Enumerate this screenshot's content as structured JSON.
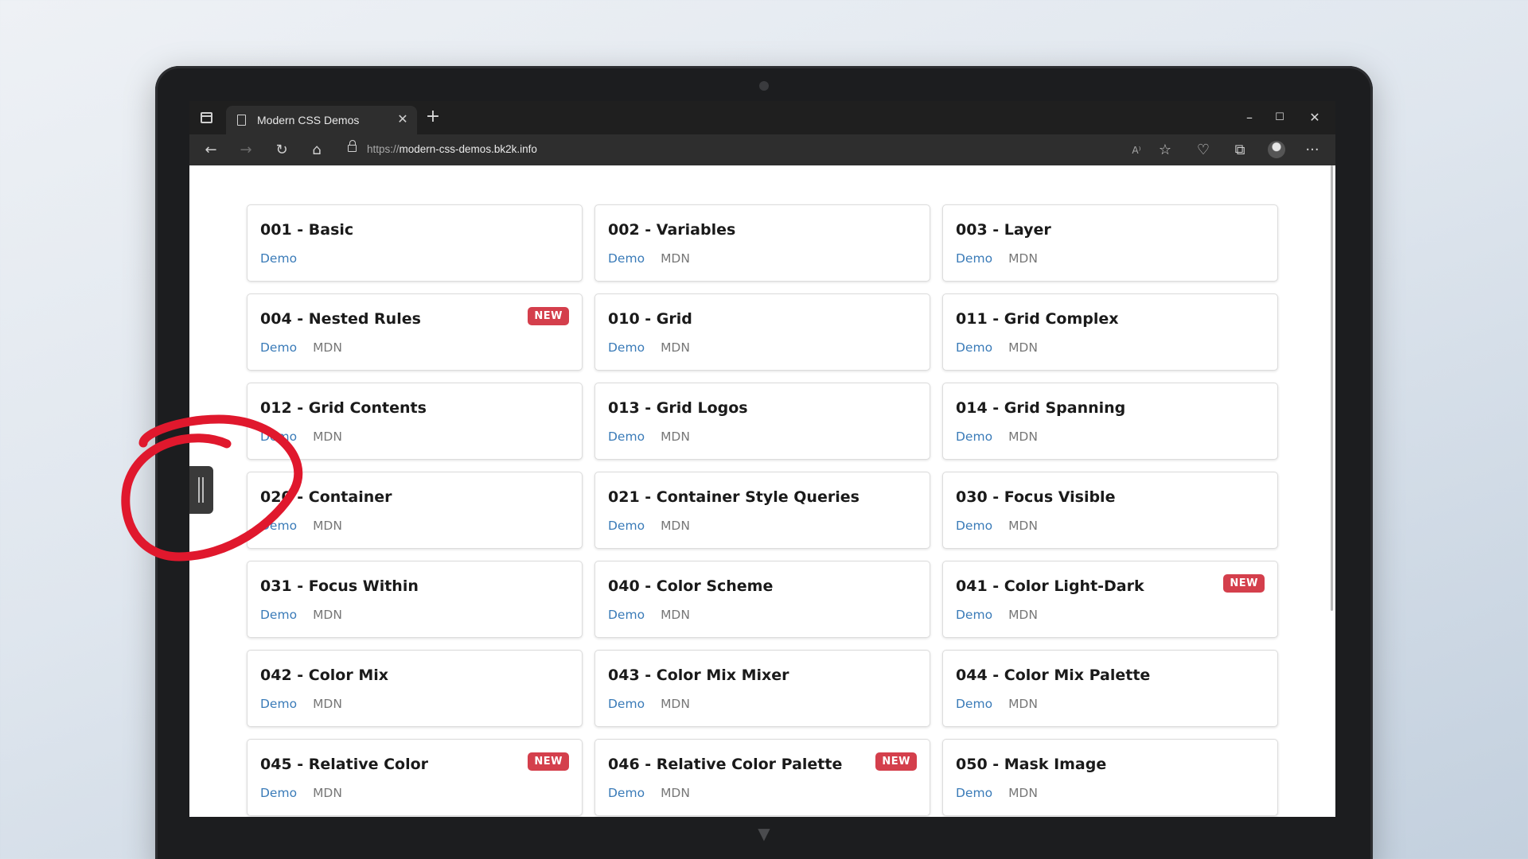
{
  "browser": {
    "tab_title": "Modern CSS Demos",
    "tab_close": "✕",
    "new_tab": "+",
    "url_scheme": "https://",
    "url_host": "modern-css-demos.bk2k.info",
    "window_controls": {
      "minimize": "–",
      "maximize": "☐",
      "close": "✕"
    },
    "toolbar_icons": {
      "back": "←",
      "forward": "→",
      "refresh": "↻",
      "home": "⌂",
      "read_aloud": "A⁾",
      "favorites": "☆",
      "browser_essentials": "♡",
      "collections": "⧉",
      "more": "···"
    }
  },
  "cards": [
    {
      "title": "001 - Basic",
      "demo": "Demo",
      "mdn": "",
      "badge": ""
    },
    {
      "title": "002 - Variables",
      "demo": "Demo",
      "mdn": "MDN",
      "badge": ""
    },
    {
      "title": "003 - Layer",
      "demo": "Demo",
      "mdn": "MDN",
      "badge": ""
    },
    {
      "title": "004 - Nested Rules",
      "demo": "Demo",
      "mdn": "MDN",
      "badge": "NEW"
    },
    {
      "title": "010 - Grid",
      "demo": "Demo",
      "mdn": "MDN",
      "badge": ""
    },
    {
      "title": "011 - Grid Complex",
      "demo": "Demo",
      "mdn": "MDN",
      "badge": ""
    },
    {
      "title": "012 - Grid Contents",
      "demo": "Demo",
      "mdn": "MDN",
      "badge": ""
    },
    {
      "title": "013 - Grid Logos",
      "demo": "Demo",
      "mdn": "MDN",
      "badge": ""
    },
    {
      "title": "014 - Grid Spanning",
      "demo": "Demo",
      "mdn": "MDN",
      "badge": ""
    },
    {
      "title": "020 - Container",
      "demo": "Demo",
      "mdn": "MDN",
      "badge": ""
    },
    {
      "title": "021 - Container Style Queries",
      "demo": "Demo",
      "mdn": "MDN",
      "badge": ""
    },
    {
      "title": "030 - Focus Visible",
      "demo": "Demo",
      "mdn": "MDN",
      "badge": ""
    },
    {
      "title": "031 - Focus Within",
      "demo": "Demo",
      "mdn": "MDN",
      "badge": ""
    },
    {
      "title": "040 - Color Scheme",
      "demo": "Demo",
      "mdn": "MDN",
      "badge": ""
    },
    {
      "title": "041 - Color Light-Dark",
      "demo": "Demo",
      "mdn": "MDN",
      "badge": "NEW"
    },
    {
      "title": "042 - Color Mix",
      "demo": "Demo",
      "mdn": "MDN",
      "badge": ""
    },
    {
      "title": "043 - Color Mix Mixer",
      "demo": "Demo",
      "mdn": "MDN",
      "badge": ""
    },
    {
      "title": "044 - Color Mix Palette",
      "demo": "Demo",
      "mdn": "MDN",
      "badge": ""
    },
    {
      "title": "045 - Relative Color",
      "demo": "Demo",
      "mdn": "MDN",
      "badge": "NEW"
    },
    {
      "title": "046 - Relative Color Palette",
      "demo": "Demo",
      "mdn": "MDN",
      "badge": "NEW"
    },
    {
      "title": "050 - Mask Image",
      "demo": "Demo",
      "mdn": "MDN",
      "badge": ""
    }
  ],
  "colors": {
    "link_demo": "#3a7bb8",
    "link_mdn": "#777777",
    "badge_bg": "#d43f4c",
    "annotation": "#e0182d"
  }
}
